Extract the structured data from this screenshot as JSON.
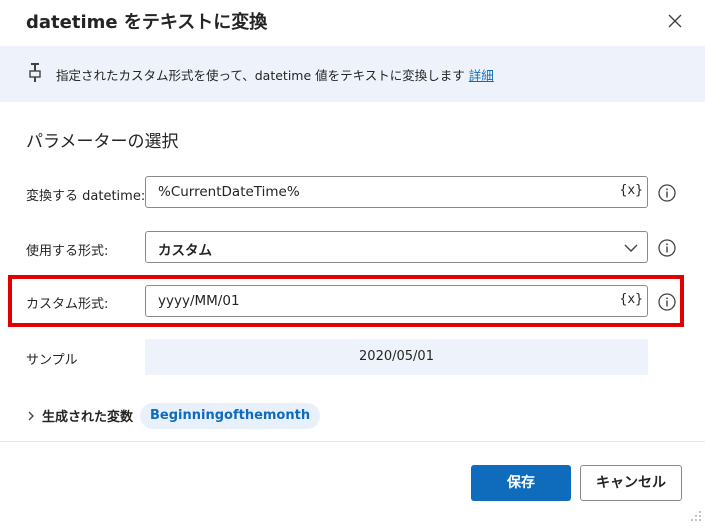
{
  "dialog": {
    "title": "datetime をテキストに変換"
  },
  "info": {
    "text": "指定されたカスタム形式を使って、datetime 値をテキストに変換します",
    "link": "詳細"
  },
  "section": {
    "title": "パラメーターの選択"
  },
  "fields": {
    "datetime": {
      "label": "変換する datetime:",
      "value": "%CurrentDateTime%",
      "var_button": "{x}"
    },
    "format": {
      "label": "使用する形式:",
      "value": "カスタム"
    },
    "custom_format": {
      "label": "カスタム形式:",
      "value": "yyyy/MM/01",
      "var_button": "{x}"
    },
    "sample": {
      "label": "サンプル",
      "value": "2020/05/01"
    }
  },
  "variables": {
    "label": "生成された変数",
    "badge": "Beginningofthemonth"
  },
  "buttons": {
    "save": "保存",
    "cancel": "キャンセル"
  },
  "colors": {
    "accent": "#0f6cbd",
    "info_bg": "#eef3fb",
    "highlight": "#e00000"
  },
  "icons": {
    "close": "close-icon",
    "info": "info-pin-icon",
    "help": "help-circle-icon",
    "chevron_down": "chevron-down-icon",
    "chevron_right": "chevron-right-icon",
    "resize": "resize-grip-icon"
  }
}
